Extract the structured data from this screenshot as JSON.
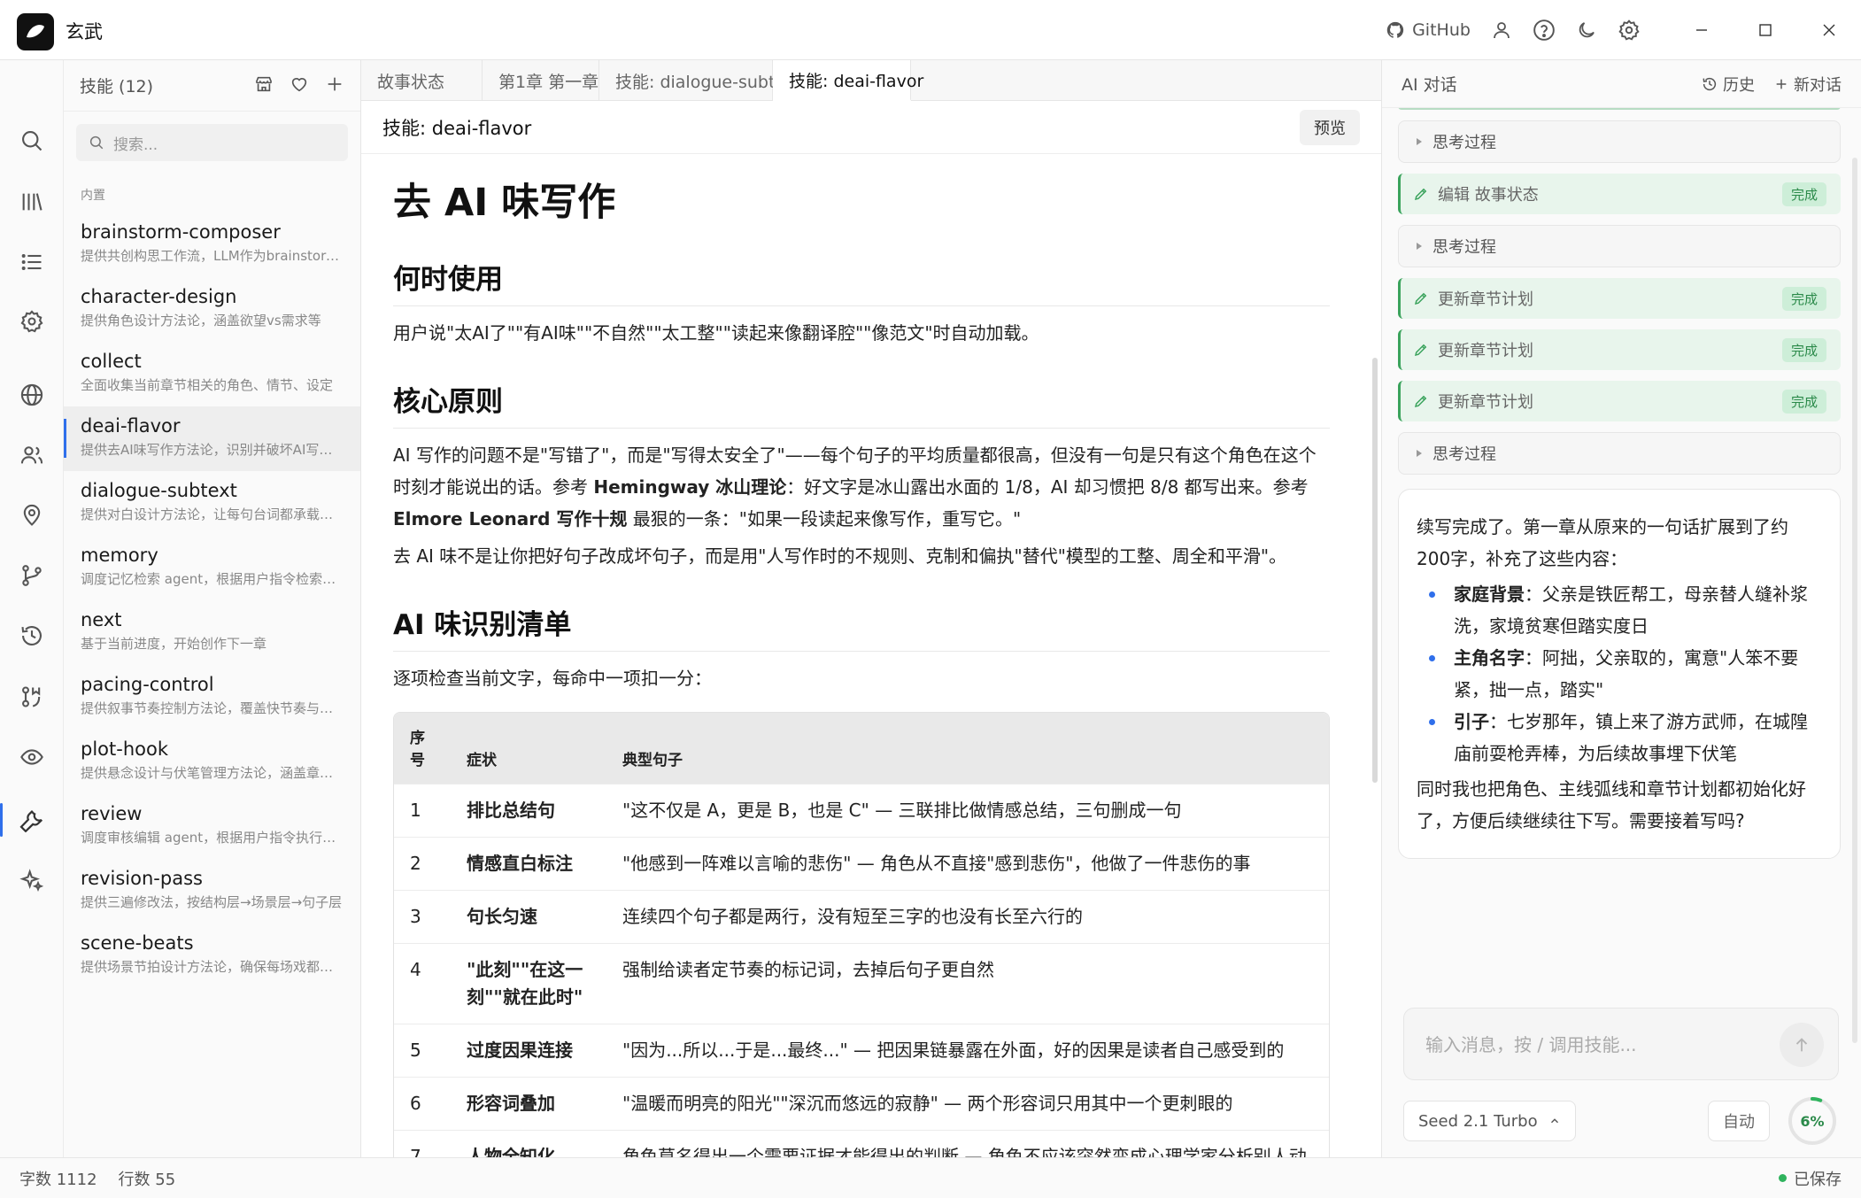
{
  "app": {
    "title": "玄武"
  },
  "titlebar": {
    "github_label": "GitHub"
  },
  "skills": {
    "title": "技能 (12)",
    "search_placeholder": "搜索...",
    "section": "内置",
    "items": [
      {
        "name": "brainstorm-composer",
        "desc": "提供共创构思工作流，LLM作为brainstorm伙伴"
      },
      {
        "name": "character-design",
        "desc": "提供角色设计方法论，涵盖欲望vs需求等"
      },
      {
        "name": "collect",
        "desc": "全面收集当前章节相关的角色、情节、设定"
      },
      {
        "name": "deai-flavor",
        "desc": "提供去AI味写作方法论，识别并破坏AI写作模式"
      },
      {
        "name": "dialogue-subtext",
        "desc": "提供对白设计方法论，让每句台词都承载潜台词"
      },
      {
        "name": "memory",
        "desc": "调度记忆检索 agent，根据用户指令检索相关记忆"
      },
      {
        "name": "next",
        "desc": "基于当前进度，开始创作下一章"
      },
      {
        "name": "pacing-control",
        "desc": "提供叙事节奏控制方法论，覆盖快节奏与慢节奏"
      },
      {
        "name": "plot-hook",
        "desc": "提供悬念设计与伏笔管理方法论，涵盖章节钩子"
      },
      {
        "name": "review",
        "desc": "调度审核编辑 agent，根据用户指令执行审核"
      },
      {
        "name": "revision-pass",
        "desc": "提供三遍修改法，按结构层→场景层→句子层"
      },
      {
        "name": "scene-beats",
        "desc": "提供场景节拍设计方法论，确保每场戏都有推进"
      }
    ]
  },
  "editor": {
    "tabs": [
      "故事状态",
      "第1章 第一章",
      "技能: dialogue-subtext",
      "技能: deai-flavor"
    ],
    "active_tab": 3,
    "doc_title": "技能: deai-flavor",
    "preview_label": "预览",
    "h1": "去 AI 味写作",
    "s1_title": "何时使用",
    "s1_text": "用户说\"太AI了\"\"有AI味\"\"不自然\"\"太工整\"\"读起来像翻译腔\"\"像范文\"时自动加载。",
    "s2_title": "核心原则",
    "s2_p1a": "AI 写作的问题不是\"写错了\"，而是\"写得太安全了\"——每个句子的平均质量都很高，但没有一句是只有这个角色在这个时刻才能说出的话。参考 ",
    "s2_p1b": "Hemingway 冰山理论",
    "s2_p1c": "：好文字是冰山露出水面的 1/8，AI 却习惯把 8/8 都写出来。参考 ",
    "s2_p1d": "Elmore Leonard 写作十规",
    "s2_p1e": " 最狠的一条：\"如果一段读起来像写作，重写它。\"",
    "s2_p2": "去 AI 味不是让你把好句子改成坏句子，而是用\"人写作时的不规则、克制和偏执\"替代\"模型的工整、周全和平滑\"。",
    "s3_title": "AI 味识别清单",
    "s3_text": "逐项检查当前文字，每命中一项扣一分：",
    "table": {
      "headers": [
        "序号",
        "症状",
        "典型句子"
      ],
      "rows": [
        {
          "n": "1",
          "sym": "排比总结句",
          "ex": "\"这不仅是 A，更是 B，也是 C\" — 三联排比做情感总结，三句删成一句"
        },
        {
          "n": "2",
          "sym": "情感直白标注",
          "ex": "\"他感到一阵难以言喻的悲伤\" — 角色从不直接\"感到悲伤\"，他做了一件悲伤的事"
        },
        {
          "n": "3",
          "sym": "句长匀速",
          "ex": "连续四个句子都是两行，没有短至三字的也没有长至六行的"
        },
        {
          "n": "4",
          "sym": "\"此刻\"\"在这一刻\"\"就在此时\"",
          "ex": "强制给读者定节奏的标记词，去掉后句子更自然"
        },
        {
          "n": "5",
          "sym": "过度因果连接",
          "ex": "\"因为...所以...于是...最终...\" — 把因果链暴露在外面，好的因果是读者自己感受到的"
        },
        {
          "n": "6",
          "sym": "形容词叠加",
          "ex": "\"温暖而明亮的阳光\"\"深沉而悠远的寂静\" — 两个形容词只用其中一个更刺眼的"
        },
        {
          "n": "7",
          "sym": "人物全知化",
          "ex": "角色莫名得出一个需要证据才能得出的判断 — 角色不应该突然变成心理学家分析别人动机"
        }
      ]
    }
  },
  "chat": {
    "title": "AI 对话",
    "history_label": "历史",
    "new_label": "新对话",
    "entries": [
      {
        "kind": "think",
        "label": "思考过程"
      },
      {
        "kind": "tool",
        "label": "编辑 故事状态",
        "status": "完成"
      },
      {
        "kind": "think",
        "label": "思考过程"
      },
      {
        "kind": "tool",
        "label": "更新章节计划",
        "status": "完成"
      },
      {
        "kind": "tool",
        "label": "更新章节计划",
        "status": "完成"
      },
      {
        "kind": "tool",
        "label": "更新章节计划",
        "status": "完成"
      },
      {
        "kind": "think",
        "label": "思考过程"
      }
    ],
    "message": {
      "intro": "续写完成了。第一章从原来的一句话扩展到了约200字，补充了这些内容：",
      "bullets": [
        {
          "b": "家庭背景",
          "t": "：父亲是铁匠帮工，母亲替人缝补浆洗，家境贫寒但踏实度日"
        },
        {
          "b": "主角名字",
          "t": "：阿拙，父亲取的，寓意\"人笨不要紧，拙一点，踏实\""
        },
        {
          "b": "引子",
          "t": "：七岁那年，镇上来了游方武师，在城隍庙前耍枪弄棒，为后续故事埋下伏笔"
        }
      ],
      "outro": "同时我也把角色、主线弧线和章节计划都初始化好了，方便后续继续往下写。需要接着写吗?"
    },
    "input_placeholder": "输入消息，按 / 调用技能...",
    "model": "Seed 2.1 Turbo",
    "auto_label": "自动",
    "context_percent": "6%",
    "context_fraction": 0.06
  },
  "status": {
    "words": "字数 1112",
    "lines": "行数 55",
    "saved": "已保存"
  }
}
